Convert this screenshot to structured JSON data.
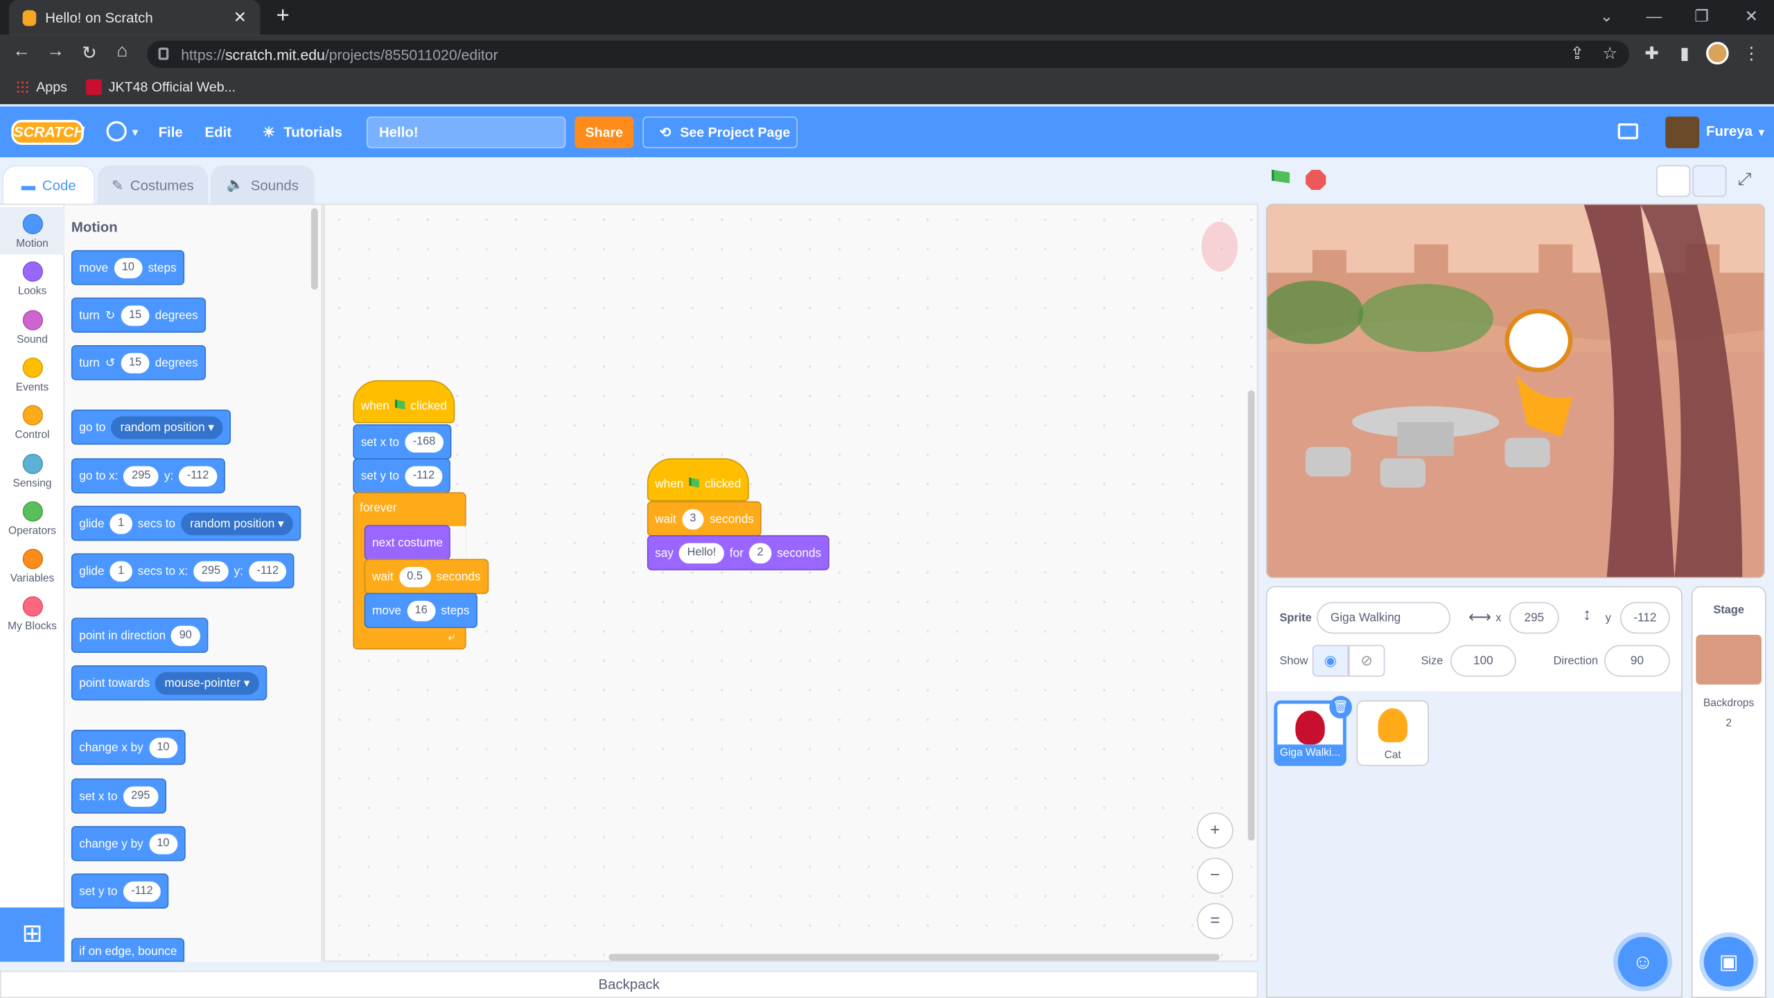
{
  "browser": {
    "tab_title": "Hello! on Scratch",
    "tab_close": "✕",
    "new_tab": "+",
    "url_scheme": "https://",
    "url_host": "scratch.mit.edu",
    "url_path": "/projects/855011020/editor",
    "bookmarks": [
      {
        "label": "Apps"
      },
      {
        "label": "JKT48 Official Web..."
      }
    ]
  },
  "menu": {
    "logo": "SCRATCH",
    "file": "File",
    "edit": "Edit",
    "tutorials": "Tutorials",
    "project_title": "Hello!",
    "share": "Share",
    "see_project_page": "See Project Page",
    "username": "Fureya"
  },
  "editor_tabs": {
    "code": "Code",
    "costumes": "Costumes",
    "sounds": "Sounds"
  },
  "categories": [
    {
      "label": "Motion",
      "color": "#4c97ff"
    },
    {
      "label": "Looks",
      "color": "#9966ff"
    },
    {
      "label": "Sound",
      "color": "#cf63cf"
    },
    {
      "label": "Events",
      "color": "#ffbf00"
    },
    {
      "label": "Control",
      "color": "#ffab19"
    },
    {
      "label": "Sensing",
      "color": "#5cb1d6"
    },
    {
      "label": "Operators",
      "color": "#59c059"
    },
    {
      "label": "Variables",
      "color": "#ff8c1a"
    },
    {
      "label": "My Blocks",
      "color": "#ff6680"
    }
  ],
  "palette": {
    "title": "Motion",
    "move": {
      "a": "move",
      "v": "10",
      "b": "steps"
    },
    "turn_cw": {
      "a": "turn",
      "v": "15",
      "b": "degrees"
    },
    "turn_ccw": {
      "a": "turn",
      "v": "15",
      "b": "degrees"
    },
    "goto": {
      "a": "go to",
      "dd": "random position"
    },
    "gotoxy": {
      "a": "go to x:",
      "x": "295",
      "b": "y:",
      "y": "-112"
    },
    "glide1": {
      "a": "glide",
      "v": "1",
      "b": "secs to",
      "dd": "random position"
    },
    "glide2": {
      "a": "glide",
      "v": "1",
      "b": "secs to x:",
      "x": "295",
      "c": "y:",
      "y": "-112"
    },
    "point": {
      "a": "point in direction",
      "v": "90"
    },
    "towards": {
      "a": "point towards",
      "dd": "mouse-pointer"
    },
    "changex": {
      "a": "change x by",
      "v": "10"
    },
    "setx": {
      "a": "set x to",
      "v": "295"
    },
    "changey": {
      "a": "change y by",
      "v": "10"
    },
    "sety": {
      "a": "set y to",
      "v": "-112"
    },
    "bounce": {
      "a": "if on edge, bounce"
    }
  },
  "script1": {
    "when": "when",
    "clicked": "clicked",
    "setx": {
      "a": "set x to",
      "v": "-168"
    },
    "sety": {
      "a": "set y to",
      "v": "-112"
    },
    "forever": "forever",
    "next_costume": "next costume",
    "wait": {
      "a": "wait",
      "v": "0.5",
      "b": "seconds"
    },
    "move": {
      "a": "move",
      "v": "16",
      "b": "steps"
    },
    "loop_arrow": "⤶"
  },
  "script2": {
    "when": "when",
    "clicked": "clicked",
    "wait": {
      "a": "wait",
      "v": "3",
      "b": "seconds"
    },
    "say": {
      "a": "say",
      "v": "Hello!",
      "b": "for",
      "v2": "2",
      "c": "seconds"
    }
  },
  "zoom": {
    "in": "+",
    "out": "−",
    "reset": "="
  },
  "backpack": "Backpack",
  "sprite_info": {
    "sprite_label": "Sprite",
    "sprite_name": "Giga Walking",
    "x_label": "x",
    "x": "295",
    "y_label": "y",
    "y": "-112",
    "show_label": "Show",
    "size_label": "Size",
    "size": "100",
    "direction_label": "Direction",
    "direction": "90"
  },
  "sprites": [
    {
      "name": "Giga Walki...",
      "selected": true
    },
    {
      "name": "Cat",
      "selected": false
    }
  ],
  "stage_pane": {
    "title": "Stage",
    "backdrops_label": "Backdrops",
    "backdrops_count": "2"
  }
}
